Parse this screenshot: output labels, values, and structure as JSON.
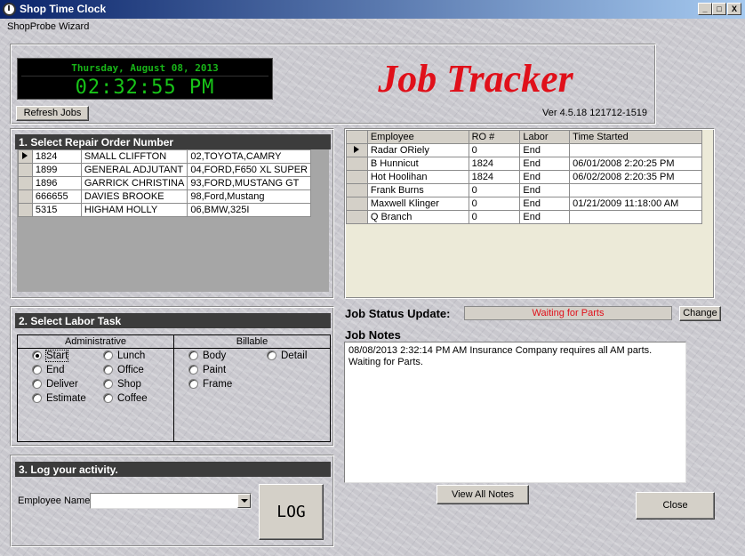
{
  "window": {
    "title": "Shop Time Clock",
    "controls": {
      "minimize": "_",
      "maximize": "□",
      "close": "X"
    }
  },
  "menu": {
    "items": [
      "ShopProbe Wizard"
    ]
  },
  "header": {
    "date": "Thursday, August 08, 2013",
    "time": "02:32:55 PM",
    "refresh_button": "Refresh Jobs",
    "app_title": "Job Tracker",
    "version": "Ver 4.5.18 121712-1519"
  },
  "repair_orders": {
    "heading": "1. Select Repair Order Number",
    "rows": [
      {
        "ro": "1824",
        "name": "SMALL CLIFFTON",
        "vehicle": "02,TOYOTA,CAMRY"
      },
      {
        "ro": "1899",
        "name": "GENERAL ADJUTANT",
        "vehicle": "04,FORD,F650 XL SUPER"
      },
      {
        "ro": "1896",
        "name": "GARRICK CHRISTINA",
        "vehicle": "93,FORD,MUSTANG GT"
      },
      {
        "ro": "666655",
        "name": "DAVIES BROOKE",
        "vehicle": "98,Ford,Mustang"
      },
      {
        "ro": "5315",
        "name": "HIGHAM HOLLY",
        "vehicle": "06,BMW,325I"
      }
    ]
  },
  "labor_task": {
    "heading": "2. Select Labor Task",
    "admin_label": "Administrative",
    "billable_label": "Billable",
    "admin_options": [
      {
        "label": "Start",
        "checked": true
      },
      {
        "label": "End",
        "checked": false
      },
      {
        "label": "Deliver",
        "checked": false
      },
      {
        "label": "Estimate",
        "checked": false
      },
      {
        "label": "Lunch",
        "checked": false
      },
      {
        "label": "Office",
        "checked": false
      },
      {
        "label": "Shop",
        "checked": false
      },
      {
        "label": "Coffee",
        "checked": false
      }
    ],
    "billable_options": [
      {
        "label": "Body",
        "checked": false
      },
      {
        "label": "Paint",
        "checked": false
      },
      {
        "label": "Frame",
        "checked": false
      },
      {
        "label": "Detail",
        "checked": false
      }
    ]
  },
  "log_activity": {
    "heading": "3. Log your activity.",
    "employee_label": "Employee Name:",
    "employee_value": "",
    "log_button": "LOG"
  },
  "tracker": {
    "columns": [
      "Employee",
      "RO #",
      "Labor",
      "Time Started"
    ],
    "rows": [
      {
        "employee": "Radar ORiely",
        "ro": "0",
        "labor": "End",
        "time": ""
      },
      {
        "employee": "B Hunnicut",
        "ro": "1824",
        "labor": "End",
        "time": "06/01/2008 2:20:25 PM"
      },
      {
        "employee": "Hot Hoolihan",
        "ro": "1824",
        "labor": "End",
        "time": "06/02/2008 2:20:35 PM"
      },
      {
        "employee": "Frank Burns",
        "ro": "0",
        "labor": "End",
        "time": ""
      },
      {
        "employee": "Maxwell Klinger",
        "ro": "0",
        "labor": "End",
        "time": "01/21/2009 11:18:00 AM"
      },
      {
        "employee": "Q Branch",
        "ro": "0",
        "labor": "End",
        "time": ""
      }
    ]
  },
  "status": {
    "label": "Job Status Update:",
    "value": "Waiting for Parts",
    "change_button": "Change"
  },
  "notes": {
    "label": "Job Notes",
    "text": "08/08/2013 2:32:14 PM AM Insurance Company requires all AM parts.  Waiting for Parts.",
    "view_all_button": "View All Notes"
  },
  "close_button": "Close",
  "colors": {
    "accent_red": "#e0101a",
    "clock_green": "#18c418",
    "header_bg": "#3c3c3c"
  }
}
